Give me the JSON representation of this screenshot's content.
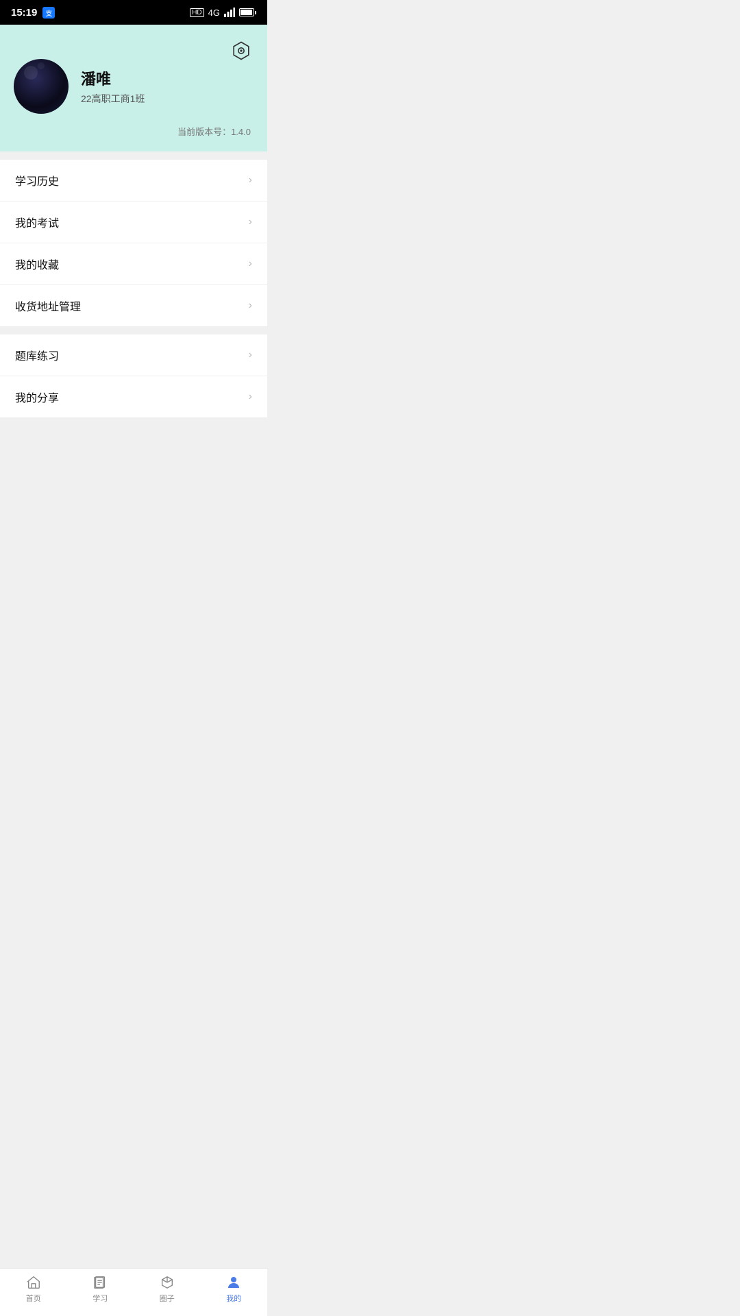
{
  "statusBar": {
    "time": "15:19",
    "alipay": "支",
    "hd": "HD",
    "signal": "4G",
    "battery": "100"
  },
  "profile": {
    "name": "潘唯",
    "class": "22高职工商1班",
    "version_label": "当前版本号：",
    "version": "1.4.0",
    "settings_icon": "settings-icon"
  },
  "menu_card_1": {
    "items": [
      {
        "label": "学习历史"
      },
      {
        "label": "我的考试"
      },
      {
        "label": "我的收藏"
      },
      {
        "label": "收货地址管理"
      }
    ]
  },
  "menu_card_2": {
    "items": [
      {
        "label": "题库练习"
      },
      {
        "label": "我的分享"
      }
    ]
  },
  "bottomNav": {
    "items": [
      {
        "label": "首页",
        "icon": "home-icon",
        "active": false
      },
      {
        "label": "学习",
        "icon": "study-icon",
        "active": false
      },
      {
        "label": "圈子",
        "icon": "circle-icon",
        "active": false
      },
      {
        "label": "我的",
        "icon": "profile-icon",
        "active": true
      }
    ]
  }
}
